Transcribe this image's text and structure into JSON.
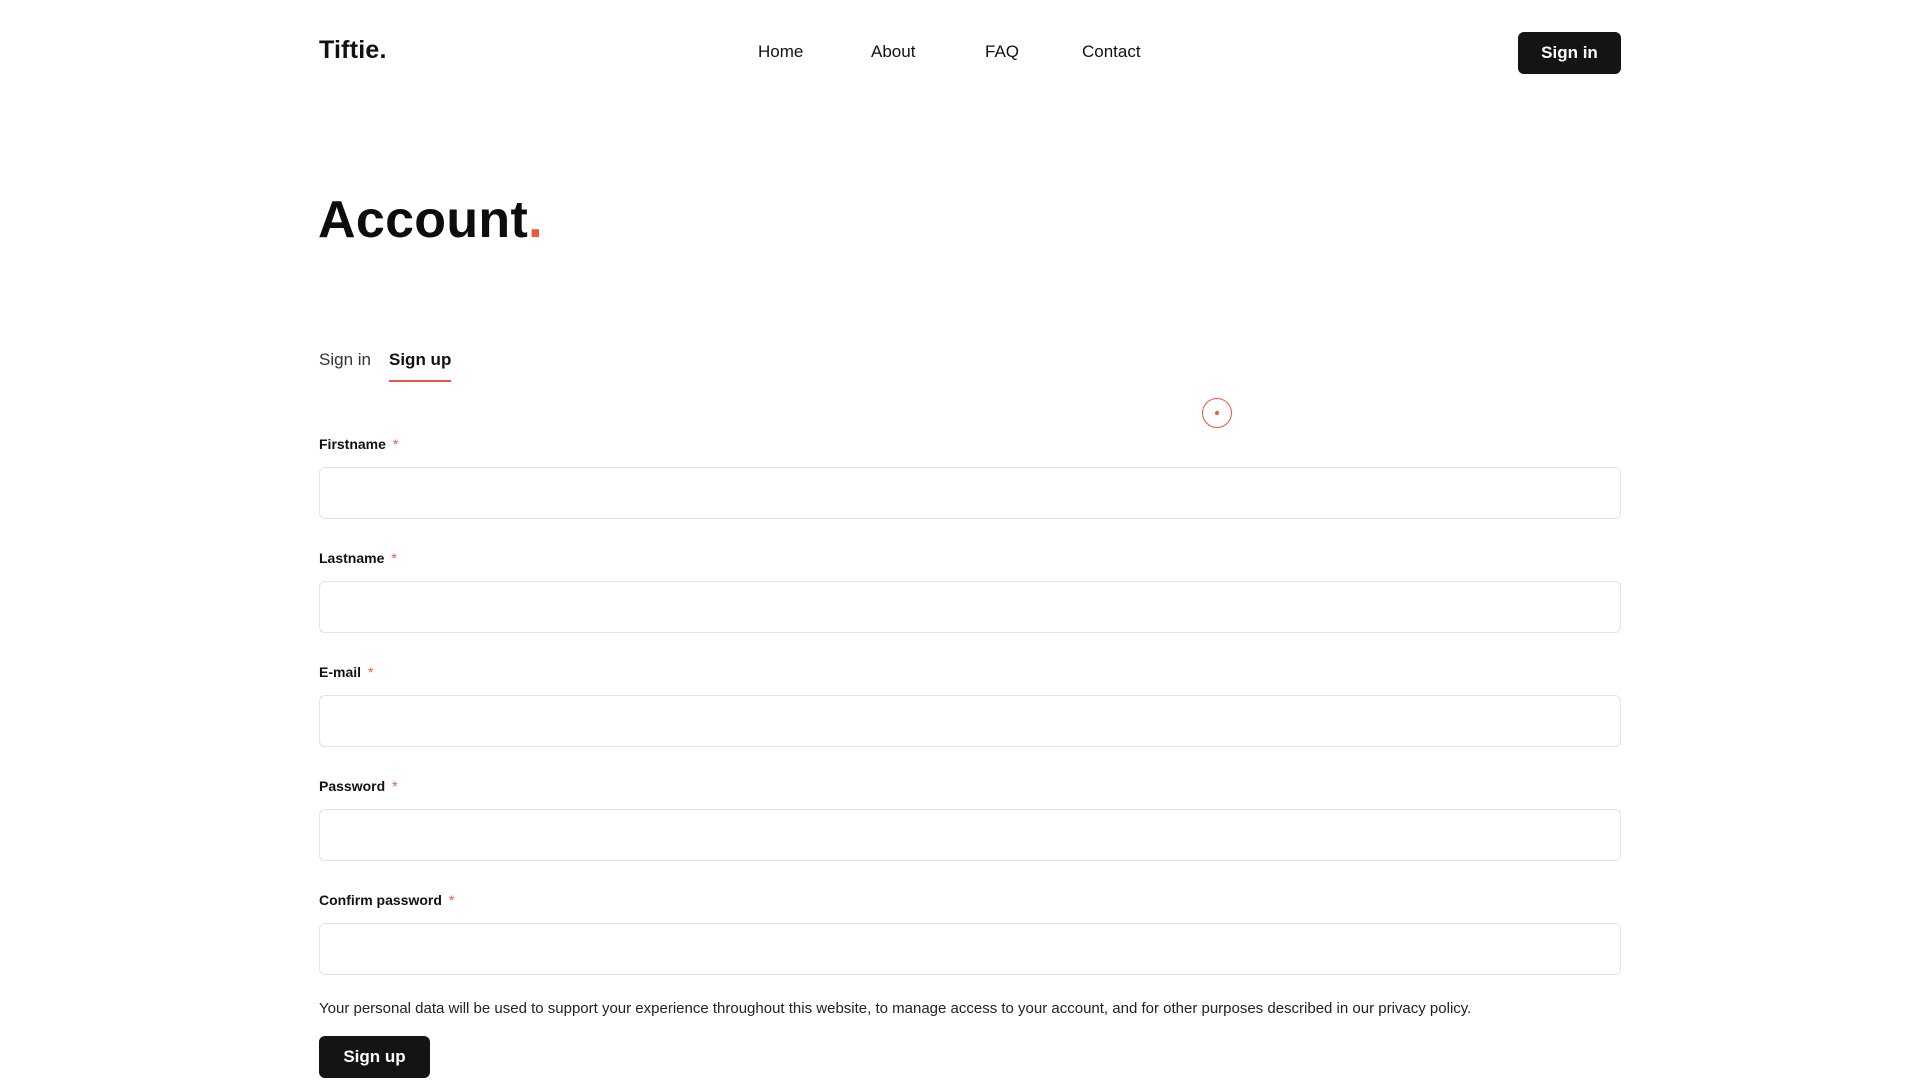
{
  "header": {
    "logo": "Tiftie.",
    "nav": [
      {
        "label": "Home"
      },
      {
        "label": "About"
      },
      {
        "label": "FAQ"
      },
      {
        "label": "Contact"
      }
    ],
    "signin_button": "Sign in"
  },
  "page": {
    "title": "Account",
    "title_dot": "."
  },
  "tabs": [
    {
      "label": "Sign in",
      "active": false
    },
    {
      "label": "Sign up",
      "active": true
    }
  ],
  "form": {
    "fields": [
      {
        "label": "Firstname",
        "required_mark": "*",
        "value": ""
      },
      {
        "label": "Lastname",
        "required_mark": "*",
        "value": ""
      },
      {
        "label": "E-mail",
        "required_mark": "*",
        "value": ""
      },
      {
        "label": "Password",
        "required_mark": "*",
        "value": ""
      },
      {
        "label": "Confirm password",
        "required_mark": "*",
        "value": ""
      }
    ],
    "privacy_notice": "Your personal data will be used to support your experience throughout this website, to manage access to your account, and for other purposes described in our privacy policy.",
    "submit_label": "Sign up"
  },
  "colors": {
    "accent": "#f0563c",
    "button_bg": "#141414",
    "input_border": "#e3e3e3"
  }
}
